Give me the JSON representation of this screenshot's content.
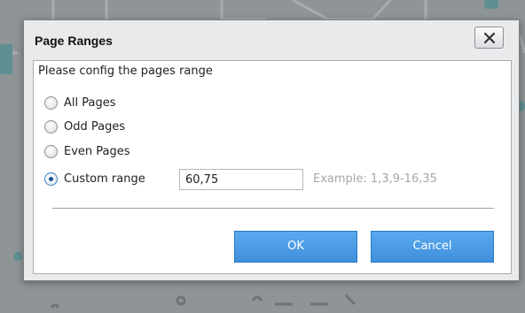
{
  "dialog": {
    "title": "Page Ranges",
    "close_icon": "close-x-icon",
    "prompt": "Please config the pages range",
    "options": [
      {
        "label": "All Pages",
        "selected": false
      },
      {
        "label": "Odd Pages",
        "selected": false
      },
      {
        "label": "Even Pages",
        "selected": false
      },
      {
        "label": "Custom range",
        "selected": true
      }
    ],
    "custom_range": {
      "value": "60,75",
      "example": "Example: 1,3,9-16,35"
    },
    "buttons": {
      "ok": "OK",
      "cancel": "Cancel"
    }
  },
  "colors": {
    "button_blue": "#4a9be6",
    "dialog_bg": "#e9eaec",
    "backdrop": "#8f9597"
  }
}
